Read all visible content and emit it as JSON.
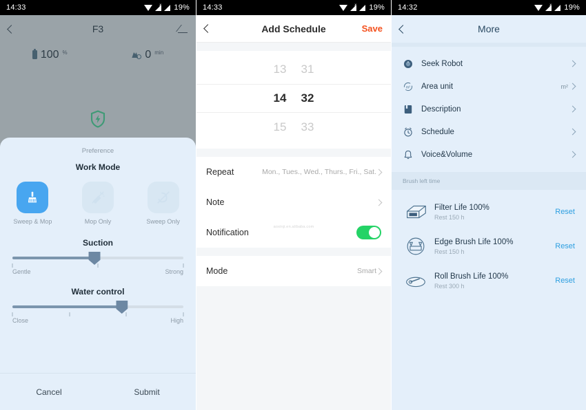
{
  "screen1": {
    "status": {
      "time": "14:33",
      "battery": "19%",
      "icons": [
        "wifi-icon",
        "signal-icon",
        "signal-icon"
      ]
    },
    "nav": {
      "back": "back-chevron-icon",
      "title": "F3",
      "action": "edit-icon"
    },
    "stats": [
      {
        "icon": "battery-icon",
        "value": "100",
        "unit": "%"
      },
      {
        "icon": "robot-timer-icon",
        "value": "0",
        "unit": "min"
      }
    ],
    "charge_icon": "charging-shield-icon",
    "sheet": {
      "title": "Preference",
      "work_mode": {
        "label": "Work Mode",
        "options": [
          {
            "label": "Sweep & Mop",
            "icon": "sweep-mop-icon",
            "selected": true
          },
          {
            "label": "Mop Only",
            "icon": "mop-only-icon",
            "selected": false
          },
          {
            "label": "Sweep Only",
            "icon": "sweep-only-icon",
            "selected": false
          }
        ],
        "selected_color": "#48a6f0"
      },
      "suction": {
        "label": "Suction",
        "min_label": "Gentle",
        "max_label": "Strong",
        "ticks": 3,
        "value_pct": 48
      },
      "water": {
        "label": "Water control",
        "min_label": "Close",
        "max_label": "High",
        "ticks": 4,
        "value_pct": 64
      },
      "cancel_label": "Cancel",
      "submit_label": "Submit"
    }
  },
  "screen2": {
    "status": {
      "time": "14:33",
      "battery": "19%"
    },
    "nav": {
      "back": "back-chevron-icon",
      "title": "Add Schedule",
      "action": "Save",
      "action_color": "#f4511e"
    },
    "picker": {
      "rows": [
        {
          "hour": "13",
          "minute": "31",
          "selected": false
        },
        {
          "hour": "14",
          "minute": "32",
          "selected": true
        },
        {
          "hour": "15",
          "minute": "33",
          "selected": false
        }
      ]
    },
    "rows": [
      {
        "label": "Repeat",
        "value": "Mon., Tues., Wed., Thurs., Fri., Sat.",
        "chevron": true,
        "toggle": null
      },
      {
        "label": "Note",
        "value": "",
        "chevron": true,
        "toggle": null
      },
      {
        "label": "Notification",
        "value": "",
        "chevron": false,
        "toggle": "on"
      }
    ],
    "watermark": "aoxinji.en.alibaba.com",
    "mode_row": {
      "label": "Mode",
      "value": "Smart",
      "chevron": true
    }
  },
  "screen3": {
    "status": {
      "time": "14:32",
      "battery": "19%"
    },
    "nav": {
      "back": "back-chevron-icon",
      "title": "More"
    },
    "menu": [
      {
        "label": "Seek Robot",
        "icon": "robot-disc-icon",
        "value": ""
      },
      {
        "label": "Area unit",
        "icon": "area-unit-icon",
        "value": "m²"
      },
      {
        "label": "Description",
        "icon": "book-icon",
        "value": ""
      },
      {
        "label": "Schedule",
        "icon": "alarm-clock-icon",
        "value": ""
      },
      {
        "label": "Voice&Volume",
        "icon": "bell-icon",
        "value": ""
      }
    ],
    "brush_section": {
      "header": "Brush left time",
      "items": [
        {
          "title": "Filter Life 100%",
          "sub": "Rest 150 h",
          "icon": "filter-icon",
          "action": "Reset"
        },
        {
          "title": "Edge Brush Life 100%",
          "sub": "Rest 150 h",
          "icon": "edge-brush-icon",
          "action": "Reset"
        },
        {
          "title": "Roll Brush Life 100%",
          "sub": "Rest 300 h",
          "icon": "roll-brush-icon",
          "action": "Reset"
        }
      ],
      "action_color": "#2e9fe0"
    }
  }
}
